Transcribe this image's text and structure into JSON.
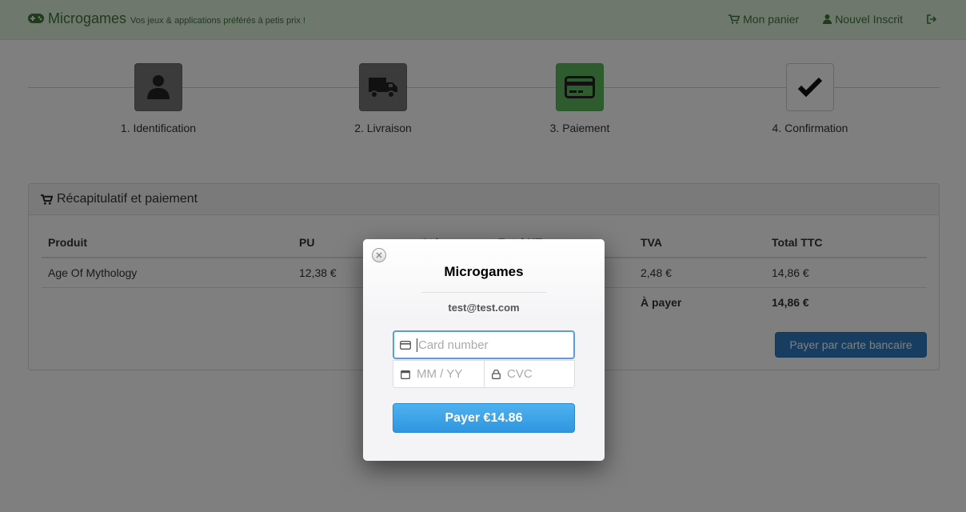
{
  "navbar": {
    "brand": "Microgames",
    "tagline": "Vos jeux & applications préférés à petis prix !",
    "links": [
      "Mon panier",
      "Nouvel Inscrit"
    ],
    "brand_color": "#3c763d"
  },
  "steps": [
    {
      "label": "1. Identification",
      "icon": "user-icon",
      "state": "done"
    },
    {
      "label": "2. Livraison",
      "icon": "truck-icon",
      "state": "done"
    },
    {
      "label": "3. Paiement",
      "icon": "credit-card-icon",
      "state": "active"
    },
    {
      "label": "4. Confirmation",
      "icon": "check-icon",
      "state": "pending"
    }
  ],
  "panel": {
    "title": "Récapitulatif et paiement",
    "columns": [
      "Produit",
      "PU",
      "Qté",
      "Total HT",
      "TVA",
      "Total TTC"
    ],
    "rows": [
      [
        "Age Of Mythology",
        "12,38 €",
        "",
        "",
        "2,48 €",
        "14,86 €"
      ]
    ],
    "total_label": "À payer",
    "total_value": "14,86 €",
    "pay_button": "Payer par carte bancaire"
  },
  "modal": {
    "title": "Microgames",
    "email": "test@test.com",
    "card_placeholder": "Card number",
    "expiry_placeholder": "MM / YY",
    "cvc_placeholder": "CVC",
    "submit_label": "Payer €14.86"
  }
}
